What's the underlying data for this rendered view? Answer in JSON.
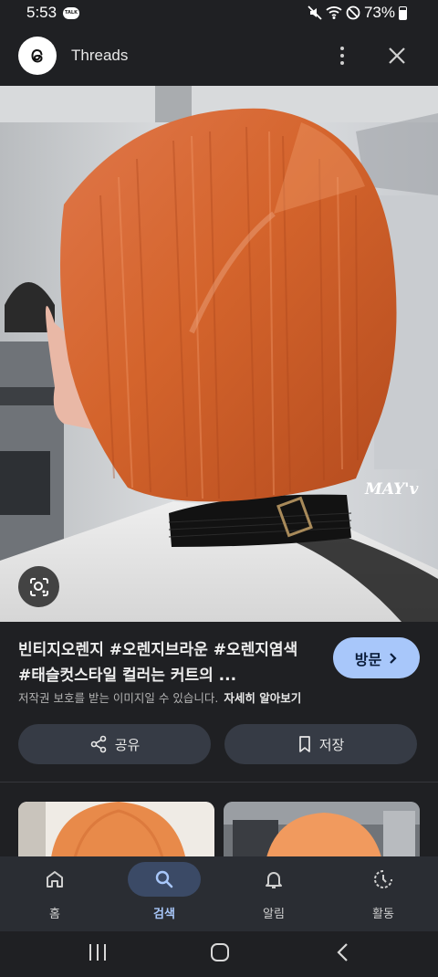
{
  "status": {
    "time": "5:53",
    "badge": "TALK",
    "battery": "73%"
  },
  "header": {
    "app_title": "Threads"
  },
  "image": {
    "watermark": "MAY'v"
  },
  "result": {
    "title": "빈티지오렌지 #오렌지브라운 #오렌지염색 #태슬컷스타일 컬러는 커트의 ...",
    "visit_label": "방문",
    "copyright": "저작권 보호를 받는 이미지일 수 있습니다.",
    "learn_more": "자세히 알아보기",
    "share_label": "공유",
    "save_label": "저장"
  },
  "bottom_nav": {
    "items": [
      {
        "label": "홈",
        "icon": "home-icon"
      },
      {
        "label": "검색",
        "icon": "search-icon",
        "active": true
      },
      {
        "label": "알림",
        "icon": "bell-icon"
      },
      {
        "label": "활동",
        "icon": "activity-icon"
      }
    ]
  },
  "colors": {
    "background": "#1f2023",
    "accent": "#a8c7fa",
    "hair": "#d4642c"
  }
}
